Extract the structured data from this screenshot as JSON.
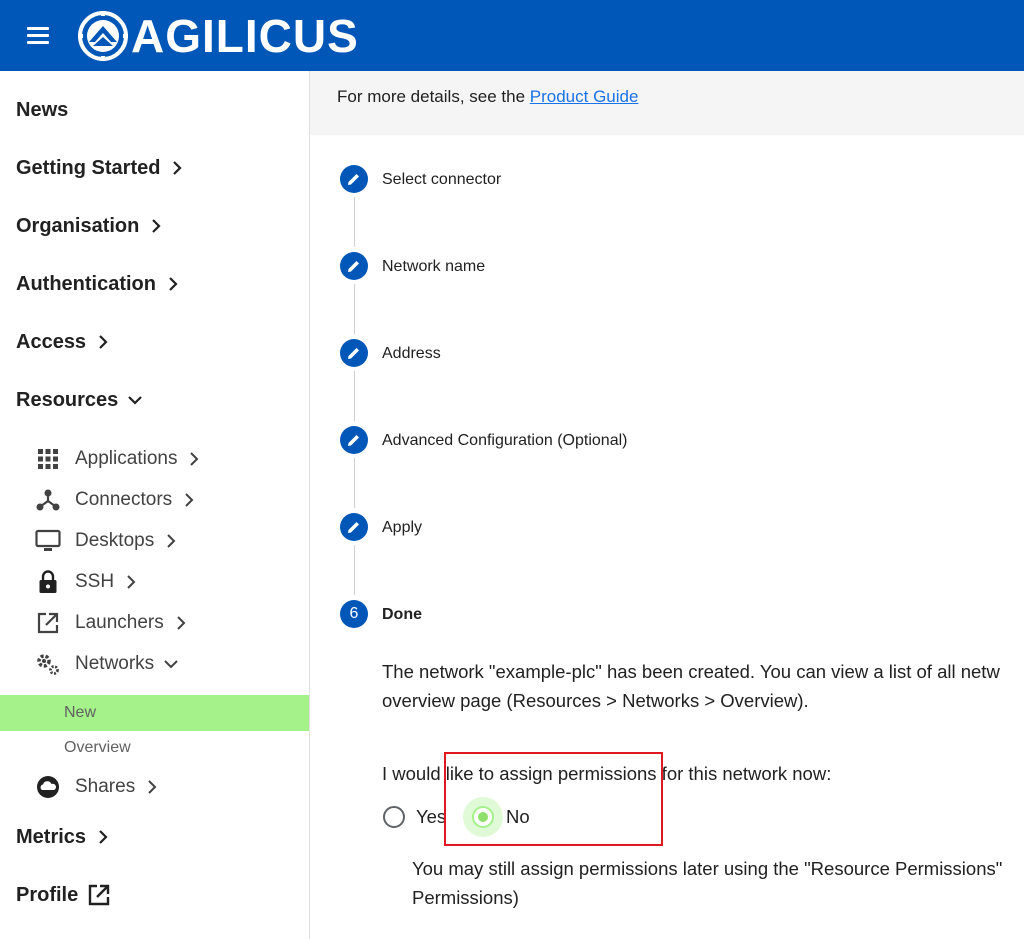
{
  "header": {
    "brand": "AGILICUS",
    "bar_color": "#0057b8"
  },
  "sidebar": {
    "top_items": [
      {
        "label": "News"
      },
      {
        "label": "Getting Started"
      },
      {
        "label": "Organisation"
      },
      {
        "label": "Authentication"
      },
      {
        "label": "Access"
      },
      {
        "label": "Resources"
      }
    ],
    "resources_children": [
      {
        "label": "Applications",
        "icon": "grid-icon"
      },
      {
        "label": "Connectors",
        "icon": "connector-icon"
      },
      {
        "label": "Desktops",
        "icon": "monitor-icon"
      },
      {
        "label": "SSH",
        "icon": "lock-icon"
      },
      {
        "label": "Launchers",
        "icon": "external-link-icon"
      },
      {
        "label": "Networks",
        "icon": "gears-icon"
      }
    ],
    "networks_children": [
      {
        "label": "New",
        "active": true
      },
      {
        "label": "Overview",
        "active": false
      }
    ],
    "after_items": [
      {
        "label": "Shares",
        "icon": "cloud-icon"
      }
    ],
    "bottom_items": [
      {
        "label": "Metrics"
      },
      {
        "label": "Profile"
      }
    ],
    "active_color": "#a5f28b"
  },
  "main": {
    "info_prefix": "For more details, see the ",
    "info_link": "Product Guide",
    "steps": [
      {
        "label": "Select connector",
        "state": "edit"
      },
      {
        "label": "Network name",
        "state": "edit"
      },
      {
        "label": "Address",
        "state": "edit"
      },
      {
        "label": "Advanced Configuration (Optional)",
        "state": "edit"
      },
      {
        "label": "Apply",
        "state": "edit"
      },
      {
        "label": "Done",
        "state": "current",
        "number": "6"
      }
    ],
    "done_text_line1": "The network \"example-plc\" has been created. You can view a list of all netw",
    "done_text_line2": "overview page (Resources > Networks > Overview).",
    "assign_question": "I would like to assign permissions for this network now:",
    "radio_yes": "Yes",
    "radio_no": "No",
    "selected": "No",
    "later_line1": "You may still assign permissions later using the \"Resource Permissions\"",
    "later_line2": "Permissions)"
  }
}
